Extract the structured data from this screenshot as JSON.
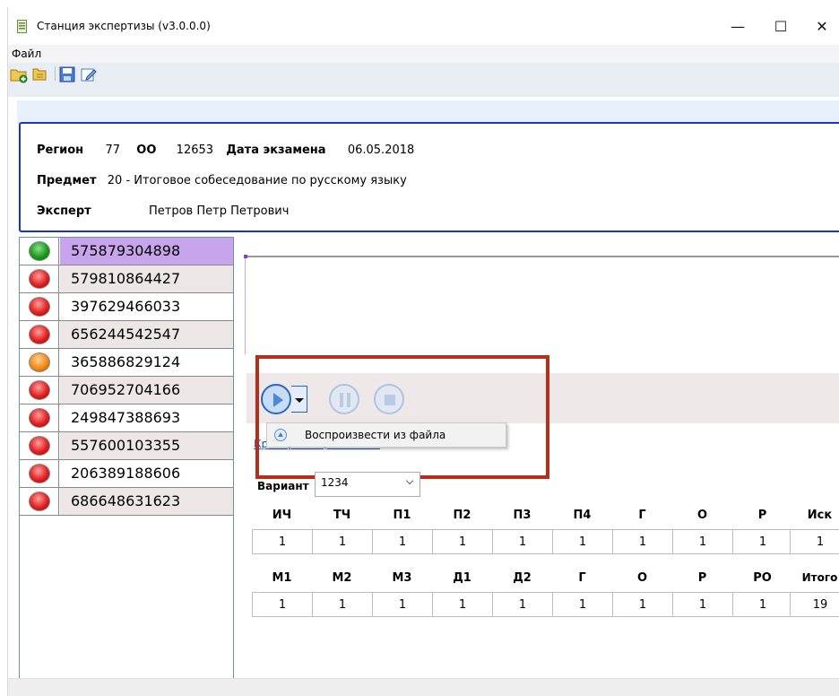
{
  "window": {
    "title": "Станция экспертизы (v3.0.0.0)",
    "minimize": "—",
    "maximize": "☐",
    "close": "✕"
  },
  "menu": {
    "file": "Файл"
  },
  "toolbar": {
    "icons": [
      "add-folder-icon",
      "folder-tree-icon",
      "save-icon",
      "edit-icon"
    ]
  },
  "info": {
    "region_label": "Регион",
    "region_value": "77",
    "oo_label": "ОО",
    "oo_value": "12653",
    "exam_date_label": "Дата экзамена",
    "exam_date_value": "06.05.2018",
    "subject_label": "Предмет",
    "subject_value": "20 - Итоговое собеседование по русскому языку",
    "expert_label": "Эксперт",
    "expert_value": "Петров Петр Петрович"
  },
  "participants": [
    {
      "id": "575879304898",
      "status": "green"
    },
    {
      "id": "579810864427",
      "status": "red"
    },
    {
      "id": "397629466033",
      "status": "red"
    },
    {
      "id": "656244542547",
      "status": "red"
    },
    {
      "id": "365886829124",
      "status": "orange"
    },
    {
      "id": "706952704166",
      "status": "red"
    },
    {
      "id": "249847388693",
      "status": "red"
    },
    {
      "id": "557600103355",
      "status": "red"
    },
    {
      "id": "206389188606",
      "status": "red"
    },
    {
      "id": "686648631623",
      "status": "red"
    }
  ],
  "player": {
    "popup_text": "Воспроизвести из файла",
    "criteria_link": "Критерии оценивания"
  },
  "variant": {
    "label": "Вариант",
    "value": "1234"
  },
  "scores": {
    "row1_headers": [
      "ИЧ",
      "ТЧ",
      "П1",
      "П2",
      "П3",
      "П4",
      "Г",
      "О",
      "Р",
      "Иск"
    ],
    "row1_values": [
      "1",
      "1",
      "1",
      "1",
      "1",
      "1",
      "1",
      "1",
      "1",
      "1"
    ],
    "row2_headers": [
      "М1",
      "М2",
      "М3",
      "Д1",
      "Д2",
      "Г",
      "О",
      "Р",
      "РО",
      "Итого"
    ],
    "row2_values": [
      "1",
      "1",
      "1",
      "1",
      "1",
      "1",
      "1",
      "1",
      "1",
      "19"
    ]
  },
  "colors": {
    "info_border": "#1b33c9",
    "selected_row": "#c8a4ec",
    "highlight": "#b5301a",
    "link": "#1a4ec4"
  }
}
